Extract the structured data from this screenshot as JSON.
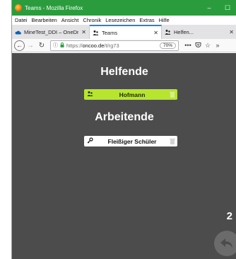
{
  "window": {
    "title": "Teams - Mozilla Firefox",
    "controls": {
      "minimize": "–",
      "maximize": "☐"
    }
  },
  "menu": [
    "Datei",
    "Bearbeiten",
    "Ansicht",
    "Chronik",
    "Lesezeichen",
    "Extras",
    "Hilfe"
  ],
  "tabs": [
    {
      "label": "MineTest_DDI – OneDri",
      "close": "✕",
      "icon": "cloud-icon"
    },
    {
      "label": "Teams",
      "close": "✕",
      "icon": "team-icon",
      "active": true
    },
    {
      "label": "Helfen...",
      "close": "✕",
      "icon": "team-icon"
    }
  ],
  "nav": {
    "url_prefix": "https://",
    "url_host": "oncoo.de",
    "url_path": "/t/rg73",
    "zoom": "70%",
    "more": "•••"
  },
  "page": {
    "heading_helpers": "Helfende",
    "helper_name": "Hofmann",
    "heading_workers": "Arbeitende",
    "worker_name": "Fleißiger Schüler",
    "counter": "2"
  },
  "colors": {
    "titlebar": "#2b9c3d",
    "content_bg": "#4c4c4c",
    "helper_card": "#b7e52f",
    "tab_accent": "#0a84ff"
  }
}
